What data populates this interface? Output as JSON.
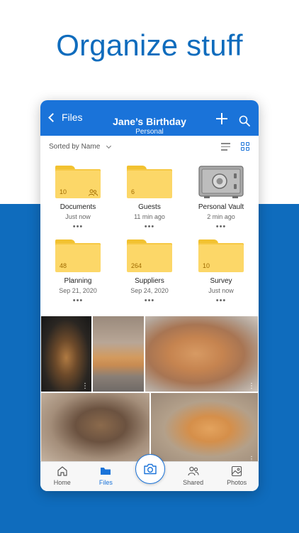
{
  "hero": {
    "title": "Organize stuff"
  },
  "header": {
    "back_label": "Files",
    "title": "Jane’s Birthday",
    "subtitle": "Personal"
  },
  "sort": {
    "label": "Sorted by Name"
  },
  "folders": [
    {
      "name": "Documents",
      "date": "Just now",
      "count": "10",
      "shared": true
    },
    {
      "name": "Guests",
      "date": "11 min ago",
      "count": "6",
      "shared": false
    },
    {
      "name": "Personal Vault",
      "date": "2 min ago",
      "count": "",
      "vault": true
    },
    {
      "name": "Planning",
      "date": "Sep 21, 2020",
      "count": "48"
    },
    {
      "name": "Suppliers",
      "date": "Sep 24, 2020",
      "count": "264"
    },
    {
      "name": "Survey",
      "date": "Just now",
      "count": "10"
    }
  ],
  "more_glyph": "•••",
  "nav": {
    "home": "Home",
    "files": "Files",
    "shared": "Shared",
    "photos": "Photos"
  },
  "colors": {
    "brand_blue": "#0f6cbd",
    "header_blue": "#1a73d9",
    "folder_yellow": "#fcd768"
  }
}
